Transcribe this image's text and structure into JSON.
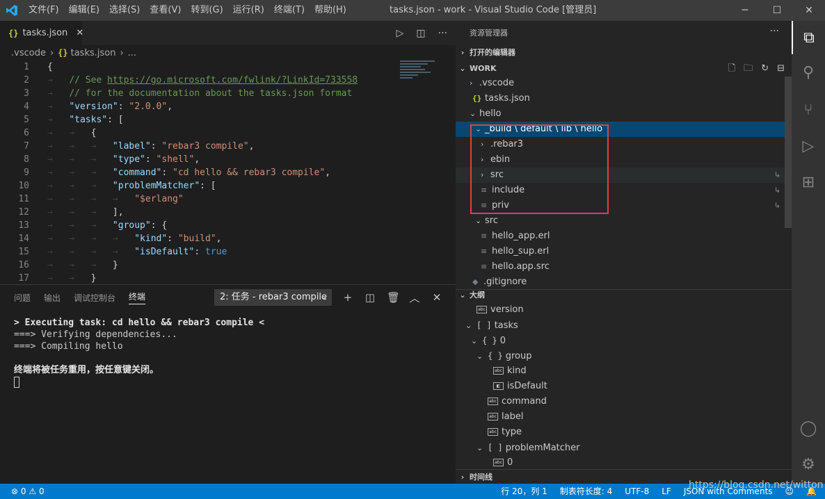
{
  "window": {
    "title": "tasks.json - work - Visual Studio Code [管理员]",
    "menu": [
      "文件(F)",
      "编辑(E)",
      "选择(S)",
      "查看(V)",
      "转到(G)",
      "运行(R)",
      "终端(T)",
      "帮助(H)"
    ]
  },
  "tab": {
    "icon": "{}",
    "label": "tasks.json"
  },
  "breadcrumb": {
    "folder": ".vscode",
    "file_icon": "{}",
    "file": "tasks.json",
    "tail": "..."
  },
  "code": {
    "line_numbers": [
      "1",
      "2",
      "3",
      "4",
      "5",
      "6",
      "7",
      "8",
      "9",
      "10",
      "11",
      "12",
      "13",
      "14",
      "15",
      "16",
      "17"
    ],
    "l1": "{",
    "l2_a": "// See ",
    "l2_link": "https://go.microsoft.com/fwlink/?LinkId=733558",
    "l3": "// for the documentation about the tasks.json format",
    "l4_key": "\"version\"",
    "l4_val": "\"2.0.0\"",
    "l5_key": "\"tasks\"",
    "l6": "{",
    "l7_key": "\"label\"",
    "l7_val": "\"rebar3 compile\"",
    "l8_key": "\"type\"",
    "l8_val": "\"shell\"",
    "l9_key": "\"command\"",
    "l9_val": "\"cd hello && rebar3 compile\"",
    "l10_key": "\"problemMatcher\"",
    "l11_val": "\"$erlang\"",
    "l12": "],",
    "l13_key": "\"group\"",
    "l14_key": "\"kind\"",
    "l14_val": "\"build\"",
    "l15_key": "\"isDefault\"",
    "l15_val": "true",
    "l16": "}",
    "l17": "}"
  },
  "panel": {
    "tabs": [
      "问题",
      "输出",
      "调试控制台",
      "终端"
    ],
    "active_tab": "终端",
    "terminal_select": "2: 任务 - rebar3 compile",
    "terminal_lines": [
      "> Executing task: cd hello && rebar3 compile <",
      "",
      "===> Verifying dependencies...",
      "===> Compiling hello"
    ],
    "reuse_message": "终端将被任务重用，按任意键关闭。"
  },
  "explorer": {
    "header": "资源管理器",
    "open_editors": "打开的编辑器",
    "workspace": "WORK",
    "tree": [
      {
        "label": ".vscode"
      },
      {
        "label": "tasks.json"
      },
      {
        "label": "hello"
      },
      {
        "label": "_build \\ default \\ lib \\ hello"
      },
      {
        "label": ".rebar3"
      },
      {
        "label": "ebin"
      },
      {
        "label": "src"
      },
      {
        "label": "include"
      },
      {
        "label": "priv"
      },
      {
        "label": "src"
      },
      {
        "label": "hello_app.erl"
      },
      {
        "label": "hello_sup.erl"
      },
      {
        "label": "hello.app.src"
      },
      {
        "label": ".gitignore"
      }
    ],
    "outline_header": "大纲",
    "outline": [
      {
        "label": "version"
      },
      {
        "label": "tasks"
      },
      {
        "label": "0"
      },
      {
        "label": "group"
      },
      {
        "label": "kind"
      },
      {
        "label": "isDefault"
      },
      {
        "label": "command"
      },
      {
        "label": "label"
      },
      {
        "label": "type"
      },
      {
        "label": "problemMatcher"
      },
      {
        "label": "0"
      }
    ],
    "timeline_header": "时间线"
  },
  "status": {
    "errors": "0",
    "warnings": "0",
    "position": "行 20，列 1",
    "tab_size": "制表符长度: 4",
    "encoding": "UTF-8",
    "eol": "LF",
    "language": "JSON with Comments"
  },
  "watermark": "https://blog.csdn.net/witton",
  "colors": {
    "accent": "#007acc",
    "highlight_box": "#e04040",
    "selection": "#094771"
  }
}
